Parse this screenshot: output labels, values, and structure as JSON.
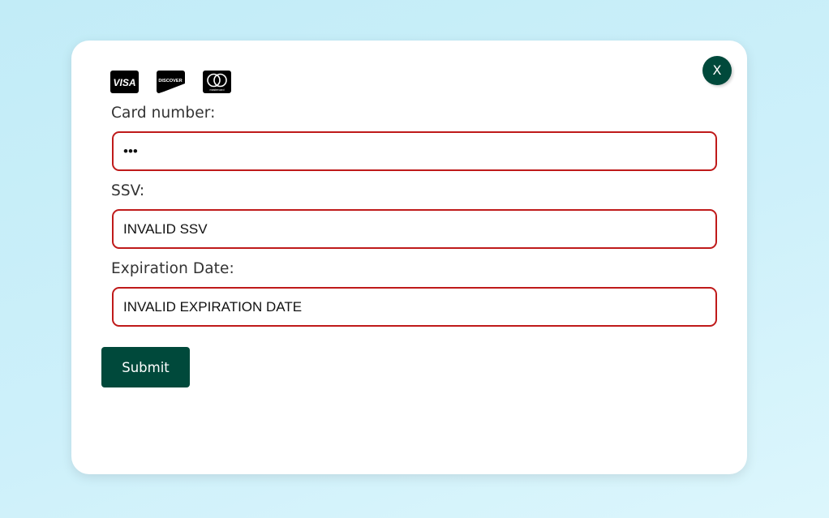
{
  "modal": {
    "close_label": "X",
    "card_logos": [
      {
        "name": "visa",
        "text": "VISA"
      },
      {
        "name": "discover",
        "text": "DISCOVER"
      },
      {
        "name": "mastercard",
        "text": "mastercard"
      }
    ],
    "fields": [
      {
        "label": "Card number:",
        "value": "•••",
        "type": "password"
      },
      {
        "label": "SSV:",
        "value": "INVALID SSV"
      },
      {
        "label": "Expiration Date:",
        "value": "INVALID EXPIRATION DATE"
      }
    ],
    "submit_label": "Submit"
  },
  "colors": {
    "accent": "#00493b",
    "error_border": "#bf1a1a",
    "background": "#c9eef8",
    "card": "#ffffff"
  }
}
